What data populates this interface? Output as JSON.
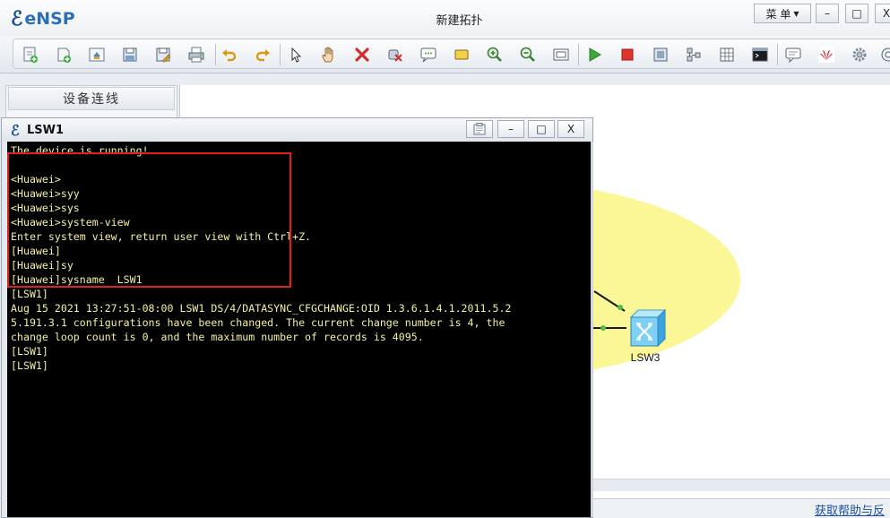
{
  "app": {
    "logo_text": "eNSP",
    "window_title": "新建拓扑",
    "menu_label": "菜 单",
    "minimize": "–",
    "maximize": "□",
    "close": "X"
  },
  "toolbar": {
    "icons": [
      "new-topology-icon",
      "new-tab-icon",
      "open-icon",
      "save-icon",
      "save-as-icon",
      "print-icon",
      "undo-icon",
      "redo-icon",
      "select-icon",
      "pan-icon",
      "delete-icon",
      "erase-link-icon",
      "text-note-icon",
      "rectangle-icon",
      "zoom-in-icon",
      "zoom-out-icon",
      "fit-icon",
      "start-device-icon",
      "stop-device-icon",
      "capture-icon",
      "topology-icon",
      "grid-icon",
      "console-icon",
      "chat-icon",
      "huawei-icon",
      "settings-icon",
      "help-icon"
    ]
  },
  "palette": {
    "header": "设备连线"
  },
  "canvas": {
    "device_label": "LSW3",
    "ellipse_color": "#fbf796",
    "link_color": "#1a1a1a",
    "port_color": "#4fbf46"
  },
  "help": {
    "link_text": "获取帮助与反"
  },
  "console": {
    "title": "LSW1",
    "minimize": "–",
    "maximize": "□",
    "close": "X",
    "text_color": "#f2f2a0",
    "lines": [
      "The device is running!",
      "",
      "<Huawei>",
      "<Huawei>syy",
      "<Huawei>sys",
      "<Huawei>system-view",
      "Enter system view, return user view with Ctrl+Z.",
      "[Huawei]",
      "[Huawei]sy",
      "[Huawei]sysname  LSW1",
      "[LSW1]",
      "Aug 15 2021 13:27:51-08:00 LSW1 DS/4/DATASYNC_CFGCHANGE:OID 1.3.6.1.4.1.2011.5.2",
      "5.191.3.1 configurations have been changed. The current change number is 4, the",
      "change loop count is 0, and the maximum number of records is 4095.",
      "[LSW1]",
      "[LSW1]"
    ]
  },
  "highlight_color": "#e02020"
}
